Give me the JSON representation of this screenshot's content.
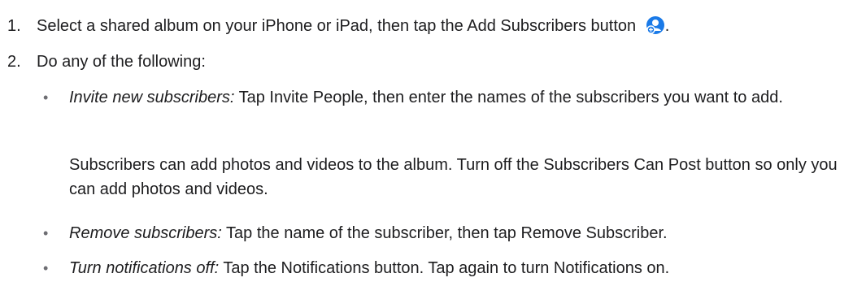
{
  "steps": [
    {
      "number": "1.",
      "text": "Select a shared album on your iPhone or iPad, then tap the Add Subscribers button",
      "end": "."
    },
    {
      "number": "2.",
      "text": "Do any of the following:"
    }
  ],
  "bullets": [
    {
      "marker": "•",
      "term": "Invite new subscribers:",
      "text": " Tap Invite People, then enter the names of the subscribers you want to add."
    },
    {
      "marker": "•",
      "term": "Remove subscribers:",
      "text": " Tap the name of the subscriber, then tap Remove Subscriber."
    },
    {
      "marker": "•",
      "term": "Turn notifications off:",
      "text": " Tap the Notifications button. Tap again to turn Notifications on."
    }
  ],
  "invite_note": "Subscribers can add photos and videos to the album. Turn off the Subscribers Can Post button so only you can add photos and videos.",
  "icons": {
    "add_subscribers": "add-subscribers-icon",
    "accent_color": "#1a7ae8"
  }
}
